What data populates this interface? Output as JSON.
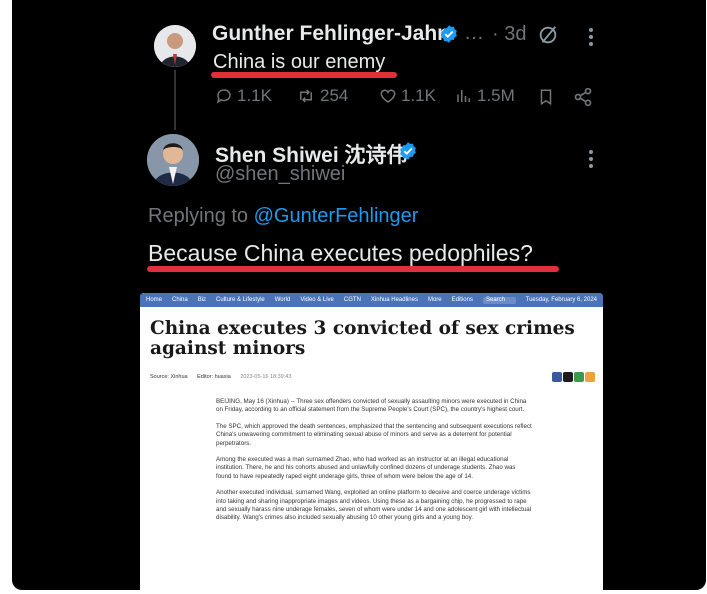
{
  "tweet1": {
    "author": "Gunther Fehlinger-Jahn",
    "more": "…",
    "time": "· 3d",
    "text": "China is our enemy",
    "stats": {
      "replies": "1.1K",
      "retweets": "254",
      "likes": "1.1K",
      "views": "1.5M"
    }
  },
  "tweet2": {
    "author": "Shen Shiwei 沈诗伟",
    "handle": "@shen_shiwei",
    "replying_prefix": "Replying to",
    "replying_handle": "@GunterFehlinger",
    "text": "Because China executes pedophiles?"
  },
  "article": {
    "nav": [
      "Home",
      "China",
      "Biz",
      "Culture & Lifestyle",
      "World",
      "Video & Live",
      "CGTN",
      "Xinhua Headlines",
      "More",
      "Editions"
    ],
    "search_label": "Search",
    "date": "Tuesday, February 6, 2024",
    "title": "China executes 3 convicted of sex crimes against minors",
    "source": "Source: Xinhua",
    "editor": "Editor: huaxia",
    "timestamp": "2023-05-16 18:39:43",
    "paragraphs": [
      "BEIJING, May 16 (Xinhua) -- Three sex offenders convicted of sexually assaulting minors were executed in China on Friday, according to an official statement from the Supreme People's Court (SPC), the country's highest court.",
      "The SPC, which approved the death sentences, emphasized that the sentencing and subsequent executions reflect China's unwavering commitment to eliminating sexual abuse of minors and serve as a deterrent for potential perpetrators.",
      "Among the executed was a man surnamed Zhao, who had worked as an instructor at an illegal educational institution. There, he and his cohorts abused and unlawfully confined dozens of underage students. Zhao was found to have repeatedly raped eight underage girls, three of whom were below the age of 14.",
      "Another executed individual, surnamed Wang, exploited an online platform to deceive and coerce underage victims into taking and sharing inappropriate images and videos. Using these as a bargaining chip, he progressed to rape and sexually harass nine underage females, seven of whom were under 14 and one adolescent girl with intellectual disability. Wang's crimes also included sexually abusing 10 other young girls and a young boy."
    ]
  },
  "colors": {
    "background": "#000000",
    "text": "#e7e9ea",
    "muted": "#71767b",
    "link": "#1d9bf0",
    "verified": "#1d9bf0",
    "underline": "#e0303a",
    "article_nav": "#4a73b8"
  }
}
